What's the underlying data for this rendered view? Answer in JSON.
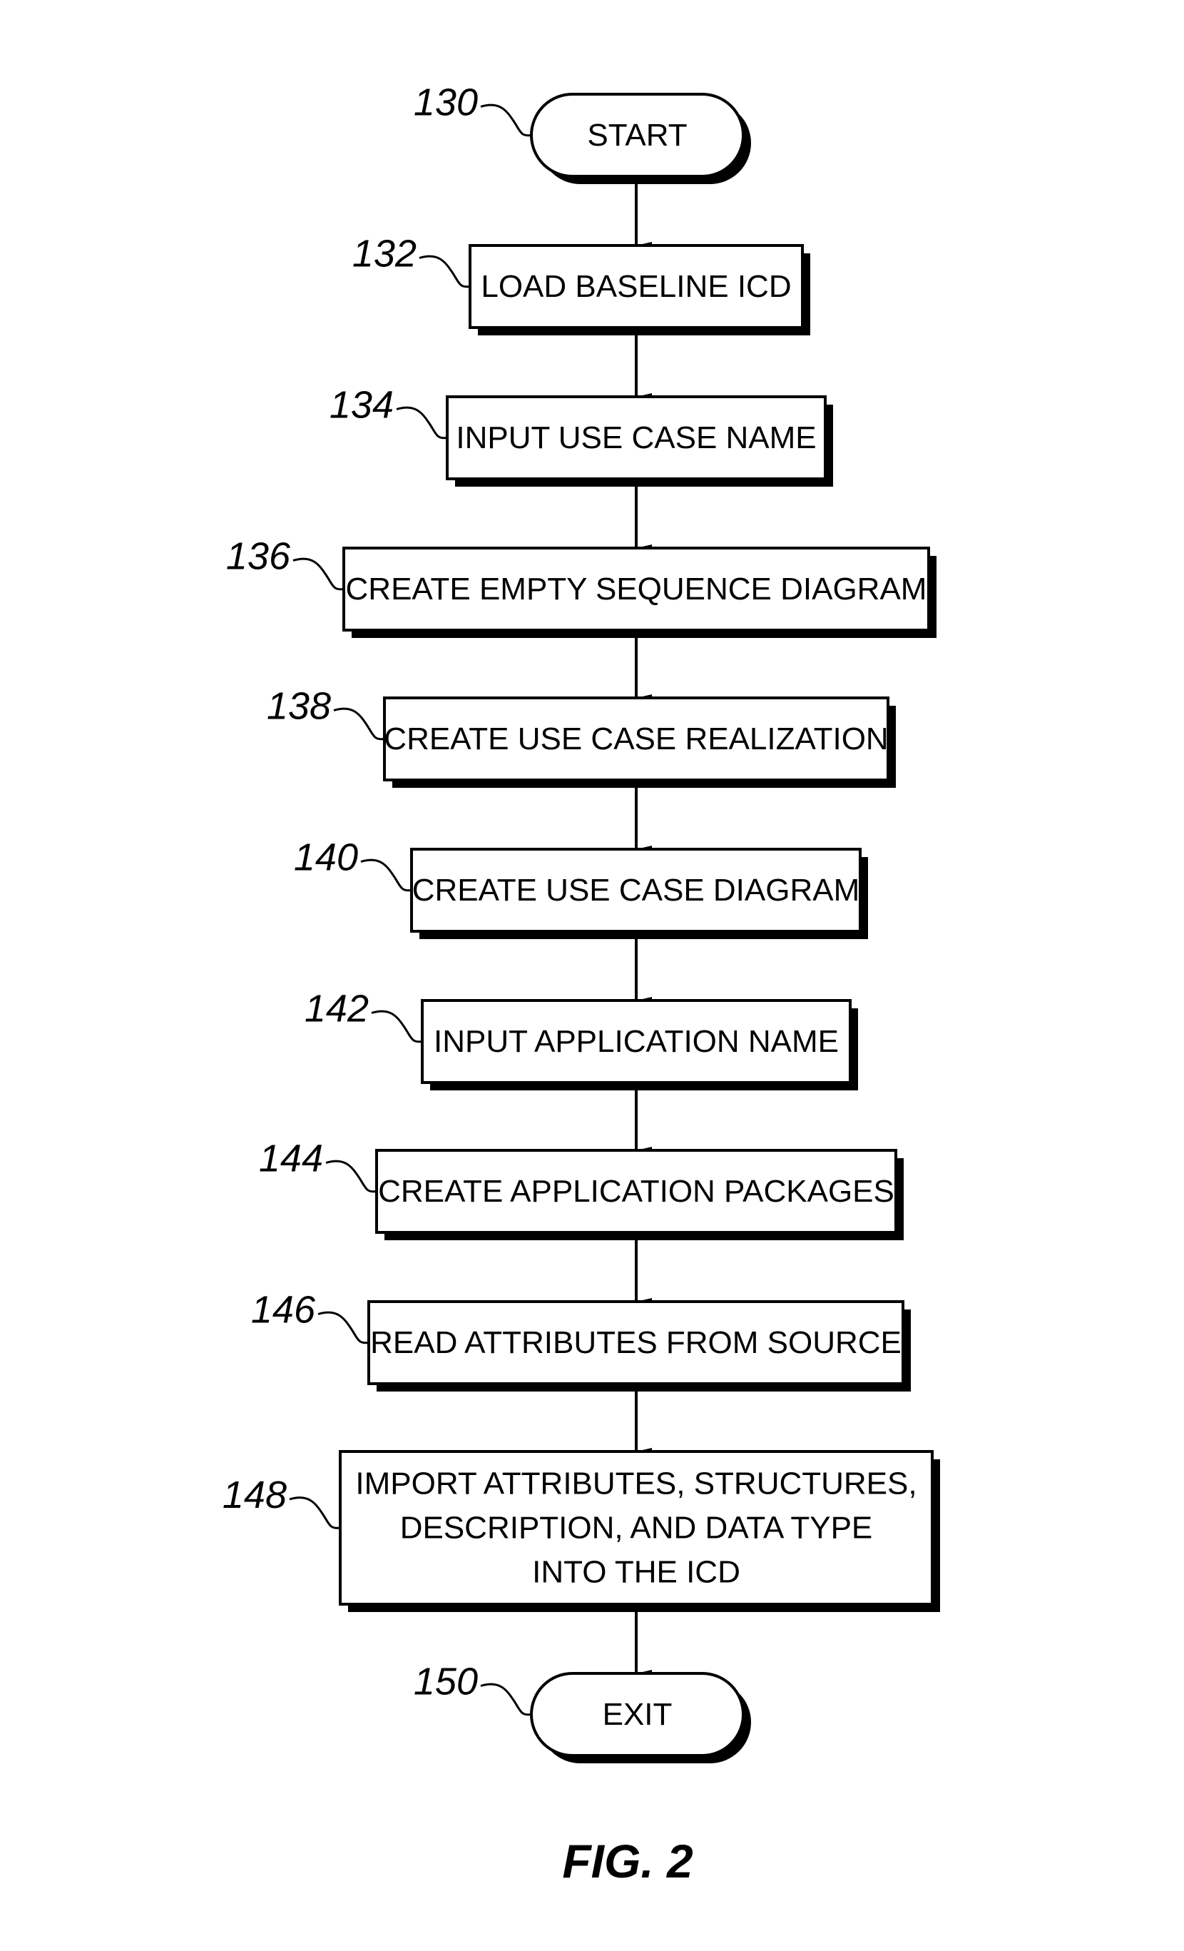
{
  "figure": {
    "label": "FIG. 2"
  },
  "nodes": [
    {
      "id": "130",
      "ref": "130",
      "type": "terminal",
      "lines": [
        "START"
      ]
    },
    {
      "id": "132",
      "ref": "132",
      "type": "process",
      "lines": [
        "LOAD BASELINE ICD"
      ]
    },
    {
      "id": "134",
      "ref": "134",
      "type": "process",
      "lines": [
        "INPUT USE CASE NAME"
      ]
    },
    {
      "id": "136",
      "ref": "136",
      "type": "process",
      "lines": [
        "CREATE EMPTY SEQUENCE DIAGRAM"
      ]
    },
    {
      "id": "138",
      "ref": "138",
      "type": "process",
      "lines": [
        "CREATE USE CASE REALIZATION"
      ]
    },
    {
      "id": "140",
      "ref": "140",
      "type": "process",
      "lines": [
        "CREATE USE CASE DIAGRAM"
      ]
    },
    {
      "id": "142",
      "ref": "142",
      "type": "process",
      "lines": [
        "INPUT APPLICATION NAME"
      ]
    },
    {
      "id": "144",
      "ref": "144",
      "type": "process",
      "lines": [
        "CREATE APPLICATION PACKAGES"
      ]
    },
    {
      "id": "146",
      "ref": "146",
      "type": "process",
      "lines": [
        "READ ATTRIBUTES FROM SOURCE"
      ]
    },
    {
      "id": "148",
      "ref": "148",
      "type": "process",
      "lines": [
        "IMPORT ATTRIBUTES, STRUCTURES,",
        "DESCRIPTION, AND DATA TYPE",
        "INTO THE ICD"
      ]
    },
    {
      "id": "150",
      "ref": "150",
      "type": "terminal",
      "lines": [
        "EXIT"
      ]
    }
  ],
  "edges": [
    [
      "130",
      "132"
    ],
    [
      "132",
      "134"
    ],
    [
      "134",
      "136"
    ],
    [
      "136",
      "138"
    ],
    [
      "138",
      "140"
    ],
    [
      "140",
      "142"
    ],
    [
      "142",
      "144"
    ],
    [
      "144",
      "146"
    ],
    [
      "146",
      "148"
    ],
    [
      "148",
      "150"
    ]
  ]
}
